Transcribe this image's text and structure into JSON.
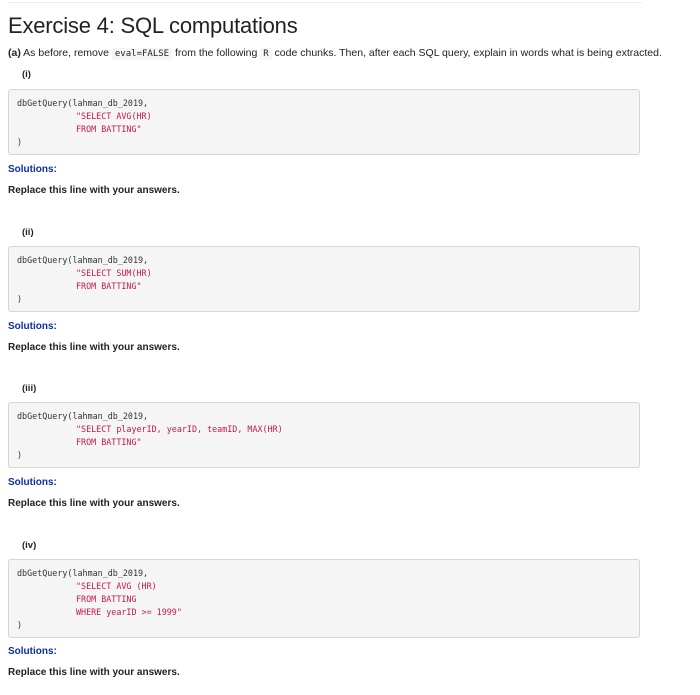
{
  "title": "Exercise 4: SQL computations",
  "intro": {
    "part": "(a)",
    "text_1": " As before, remove ",
    "code_1": "eval=FALSE",
    "text_2": " from the following ",
    "code_2": "R",
    "text_3": " code chunks. Then, after each SQL query, explain in words what is being extracted."
  },
  "sections": [
    {
      "label": "(i)",
      "code_call": "dbGetQuery(lahman_db_2019,",
      "code_lines": [
        "\"SELECT AVG(HR)",
        "FROM BATTING\""
      ],
      "code_close": ")",
      "solutions": "Solutions:",
      "answer": "Replace this line with your answers."
    },
    {
      "label": "(ii)",
      "code_call": "dbGetQuery(lahman_db_2019,",
      "code_lines": [
        "\"SELECT SUM(HR)",
        "FROM BATTING\""
      ],
      "code_close": ")",
      "solutions": "Solutions:",
      "answer": "Replace this line with your answers."
    },
    {
      "label": "(iii)",
      "code_call": "dbGetQuery(lahman_db_2019,",
      "code_lines": [
        "\"SELECT playerID, yearID, teamID, MAX(HR)",
        "FROM BATTING\""
      ],
      "code_close": ")",
      "solutions": "Solutions:",
      "answer": "Replace this line with your answers."
    },
    {
      "label": "(iv)",
      "code_call": "dbGetQuery(lahman_db_2019,",
      "code_lines": [
        "\"SELECT AVG (HR)",
        "FROM BATTING",
        "WHERE yearID >= 1999\""
      ],
      "code_close": ")",
      "solutions": "Solutions:",
      "answer": "Replace this line with your answers."
    }
  ],
  "colors": {
    "solutions": "#0b2fa3",
    "code_string": "#c41a4a",
    "code_background": "#f5f5f5"
  }
}
